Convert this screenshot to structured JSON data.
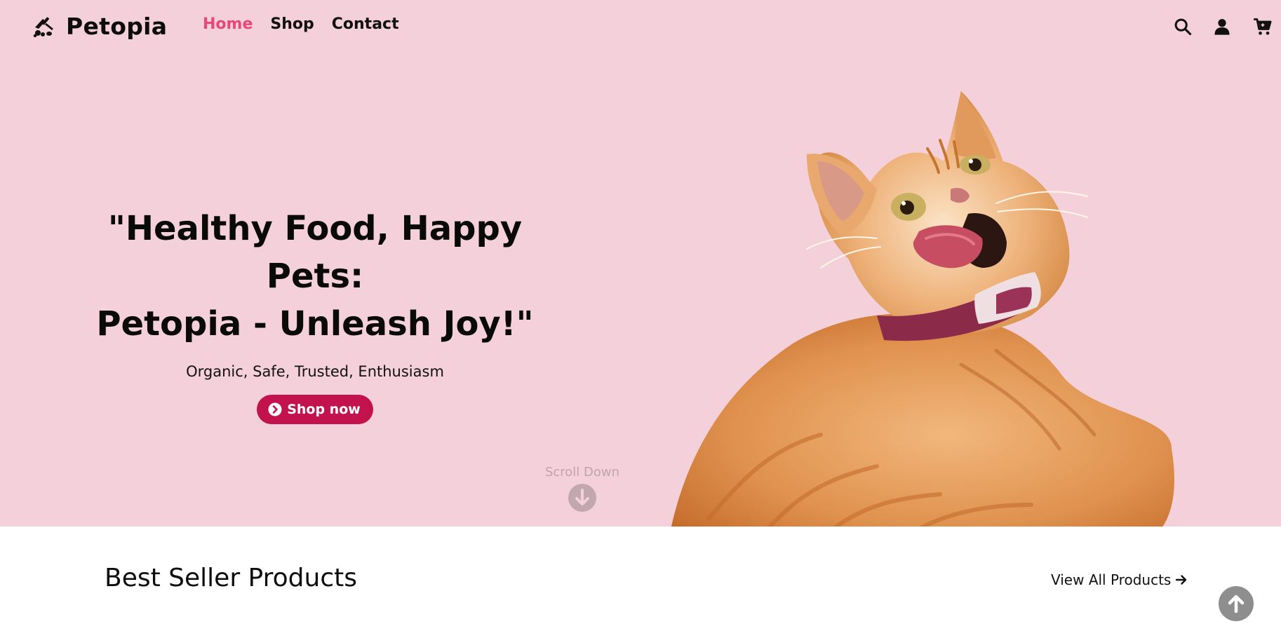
{
  "brand": {
    "name": "Petopia",
    "logo_icon": "pet-grooming-logo-icon"
  },
  "nav": {
    "links": [
      {
        "label": "Home",
        "active": true
      },
      {
        "label": "Shop",
        "active": false
      },
      {
        "label": "Contact",
        "active": false
      }
    ],
    "icons": [
      "search-icon",
      "user-icon",
      "cart-icon"
    ]
  },
  "hero": {
    "headline_line1": "\"Healthy Food, Happy Pets:",
    "headline_line2": "Petopia - Unleash Joy!\"",
    "tagline": "Organic, Safe, Trusted, Enthusiasm",
    "cta_label": "Shop now",
    "scroll_label": "Scroll Down"
  },
  "section": {
    "title": "Best Seller Products",
    "view_all_label": "View All Products"
  },
  "colors": {
    "hero_background": "#f4d1da",
    "nav_active": "#e8477b",
    "cta_background": "#c2134f",
    "scroll_to_top": "#8e8e8e"
  }
}
